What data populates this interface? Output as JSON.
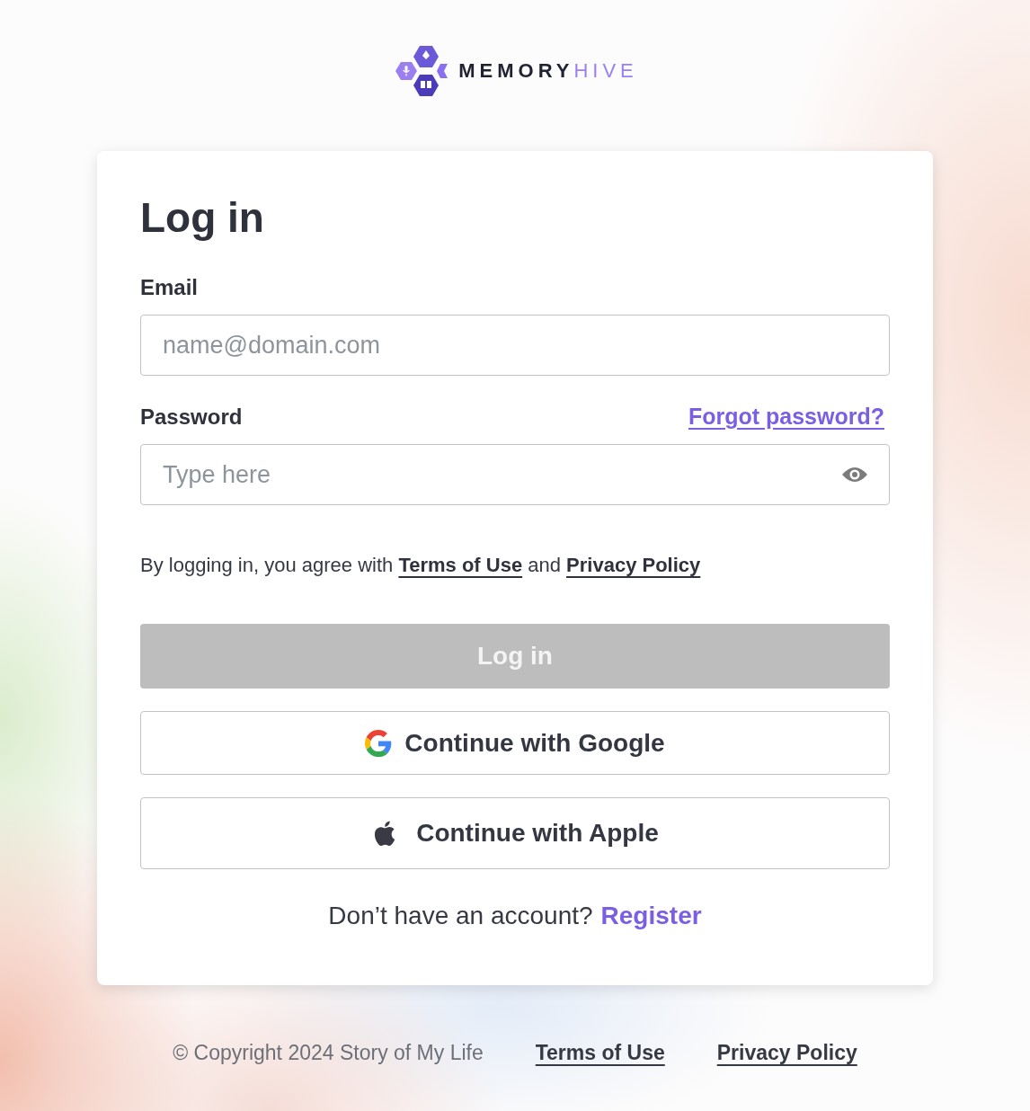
{
  "logo": {
    "primary": "MEMORY",
    "secondary": "HIVE"
  },
  "card": {
    "title": "Log in",
    "email": {
      "label": "Email",
      "placeholder": "name@domain.com"
    },
    "password": {
      "label": "Password",
      "placeholder": "Type here",
      "forgot": "Forgot password?"
    },
    "terms": {
      "prefix": "By logging in, you agree with",
      "terms_link": "Terms of Use",
      "middle": "and",
      "privacy_link": "Privacy Policy"
    },
    "login_button": {
      "label": "Log in",
      "disabled": true
    },
    "providers": [
      {
        "kind": "google",
        "label": "Continue with Google"
      },
      {
        "kind": "apple",
        "label": "Continue with Apple"
      }
    ],
    "register": {
      "prompt": "Don’t have an account?",
      "link": "Register"
    }
  },
  "footer": {
    "copyright": "© Copyright 2024 Story of My Life",
    "links": [
      "Terms of Use",
      "Privacy Policy"
    ]
  }
}
